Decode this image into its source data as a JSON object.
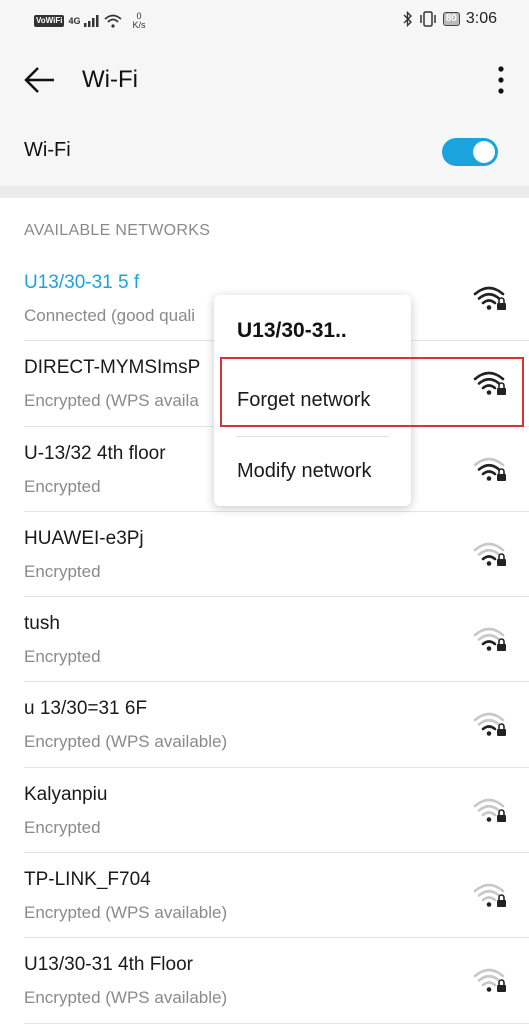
{
  "status_bar": {
    "vowifi": "VoWiFi",
    "network": "4G",
    "speed_value": "0",
    "speed_unit": "K/s",
    "battery": "80",
    "time": "3:06"
  },
  "app_bar": {
    "title": "Wi-Fi"
  },
  "wifi_toggle": {
    "label": "Wi-Fi",
    "on": true
  },
  "section_header": "AVAILABLE NETWORKS",
  "networks": [
    {
      "name": "U13/30-31 5 f",
      "status": "Connected (good quali",
      "connected": true,
      "signal": 4
    },
    {
      "name": "DIRECT-MYMSImsP",
      "status": "Encrypted (WPS availa",
      "connected": false,
      "signal": 4
    },
    {
      "name": "U-13/32 4th floor",
      "status": "Encrypted",
      "connected": false,
      "signal": 3
    },
    {
      "name": "HUAWEI-e3Pj",
      "status": "Encrypted",
      "connected": false,
      "signal": 2
    },
    {
      "name": "tush",
      "status": "Encrypted",
      "connected": false,
      "signal": 2
    },
    {
      "name": "u 13/30=31 6F",
      "status": "Encrypted (WPS available)",
      "connected": false,
      "signal": 2
    },
    {
      "name": "Kalyanpiu",
      "status": "Encrypted",
      "connected": false,
      "signal": 1
    },
    {
      "name": "TP-LINK_F704",
      "status": "Encrypted (WPS available)",
      "connected": false,
      "signal": 1
    },
    {
      "name": "U13/30-31 4th Floor",
      "status": "Encrypted (WPS available)",
      "connected": false,
      "signal": 1
    }
  ],
  "context_menu": {
    "title": "U13/30-31..",
    "items": [
      "Forget network",
      "Modify network"
    ]
  },
  "colors": {
    "accent": "#1aa3dd",
    "highlight": "#d9303a"
  }
}
